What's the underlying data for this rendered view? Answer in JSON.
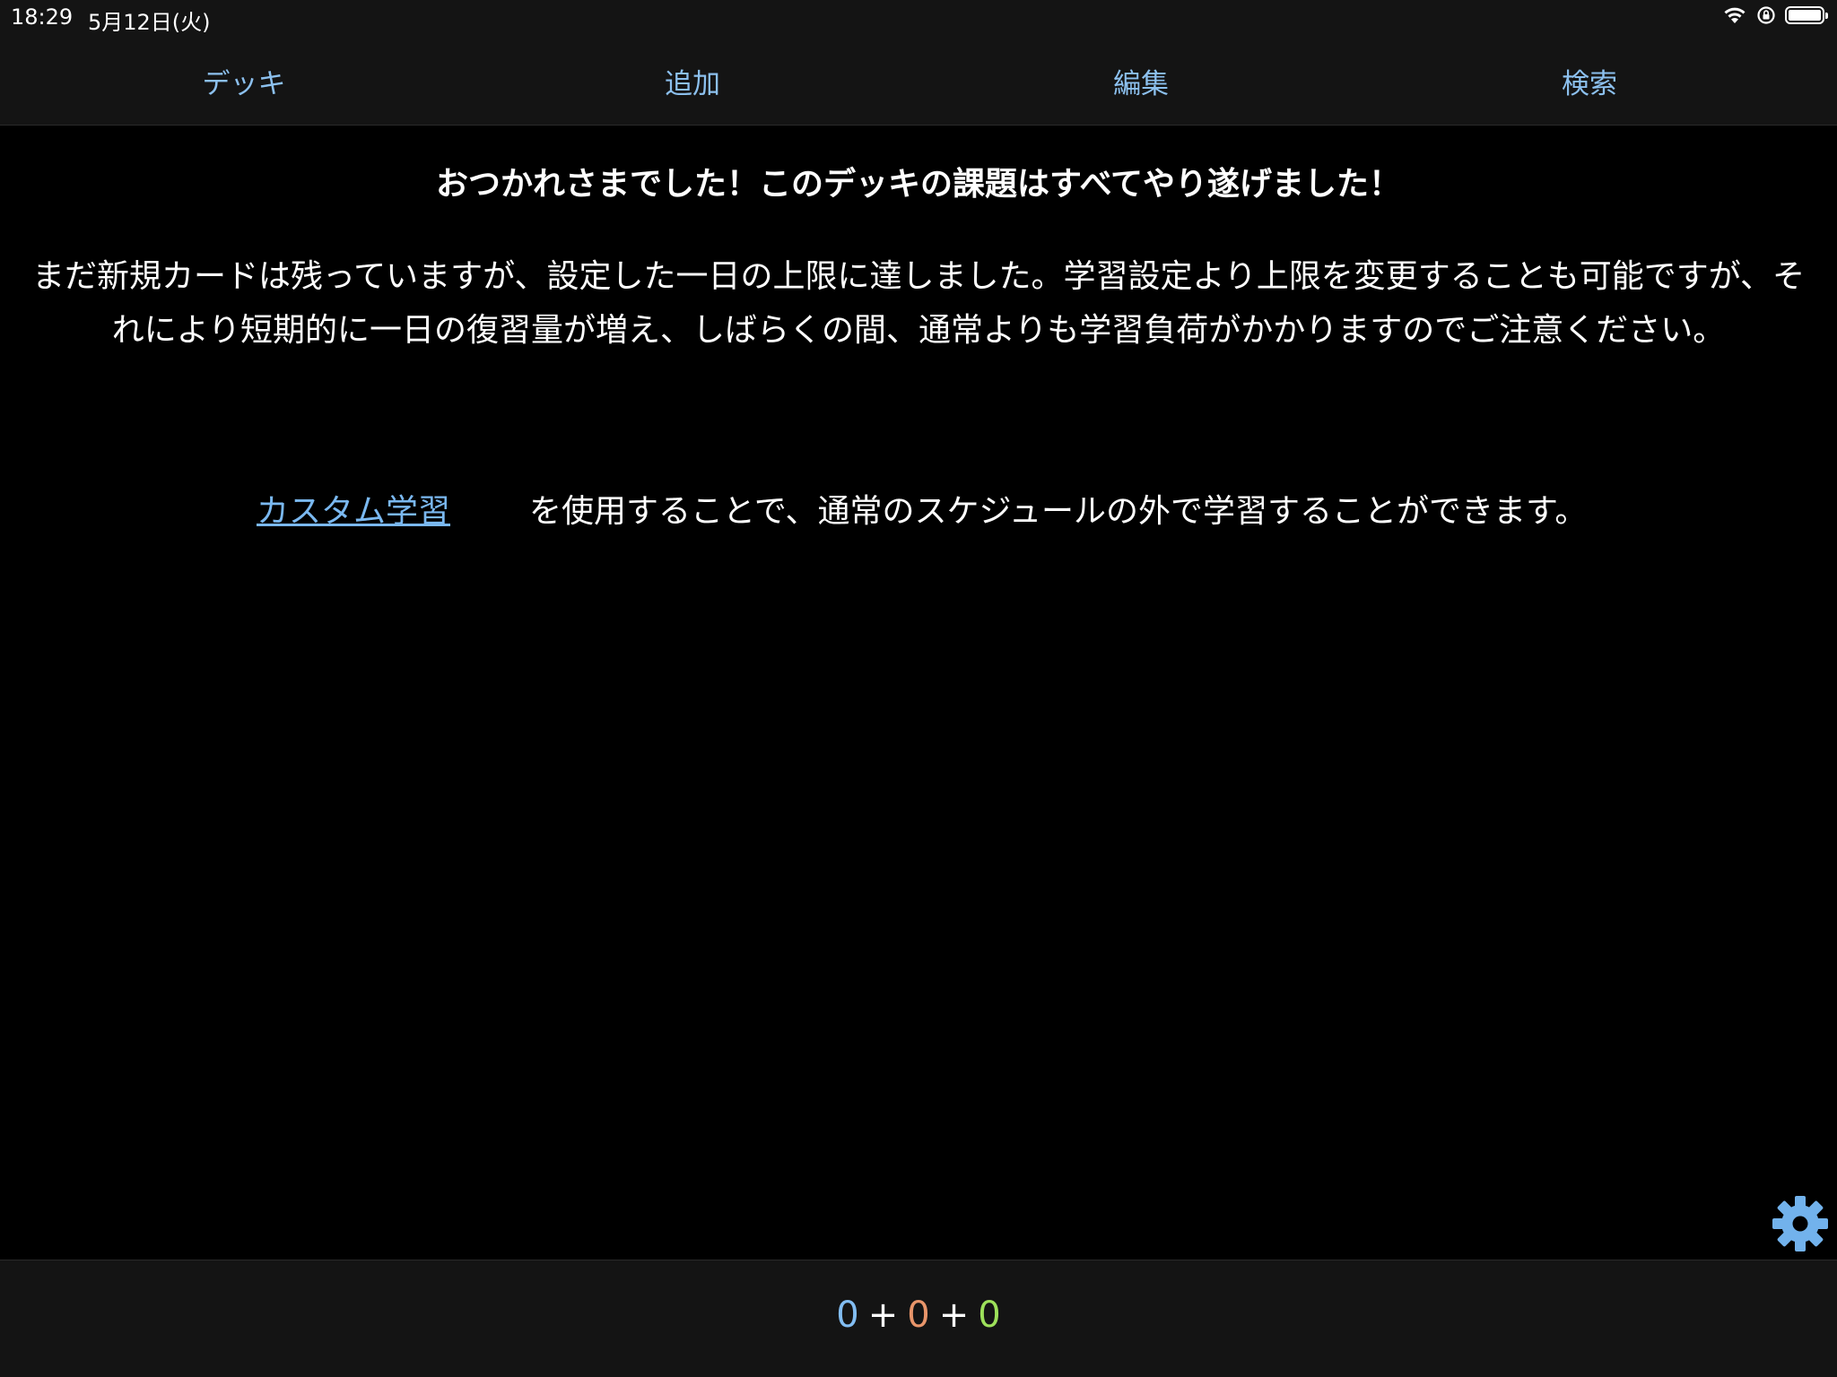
{
  "status_bar": {
    "time": "18:29",
    "date": "5月12日(火)",
    "icons": [
      "wifi-icon",
      "rotation-lock-icon",
      "battery-icon"
    ]
  },
  "nav": {
    "items": [
      {
        "label": "デッキ"
      },
      {
        "label": "追加"
      },
      {
        "label": "編集"
      },
      {
        "label": "検索"
      }
    ],
    "color": "#8cc0ee"
  },
  "main": {
    "heading": "おつかれさまでした！このデッキの課題はすべてやり遂げました！",
    "message": "まだ新規カードは残っていますが、設定した一日の上限に達しました。学習設定より上限を変更することも可能ですが、それにより短期的に一日の復習量が増え、しばらくの間、通常よりも学習負荷がかかりますのでご注意ください。",
    "custom_study_link": "カスタム学習",
    "custom_study_text": "を使用することで、通常のスケジュールの外で学習することができます。"
  },
  "bottom": {
    "new_count": "0",
    "learn_count": "0",
    "review_count": "0",
    "plus": "+",
    "colors": {
      "new": "#82bdf2",
      "learn": "#e8956a",
      "review": "#9de05a"
    }
  },
  "settings_icon": "gear-icon"
}
